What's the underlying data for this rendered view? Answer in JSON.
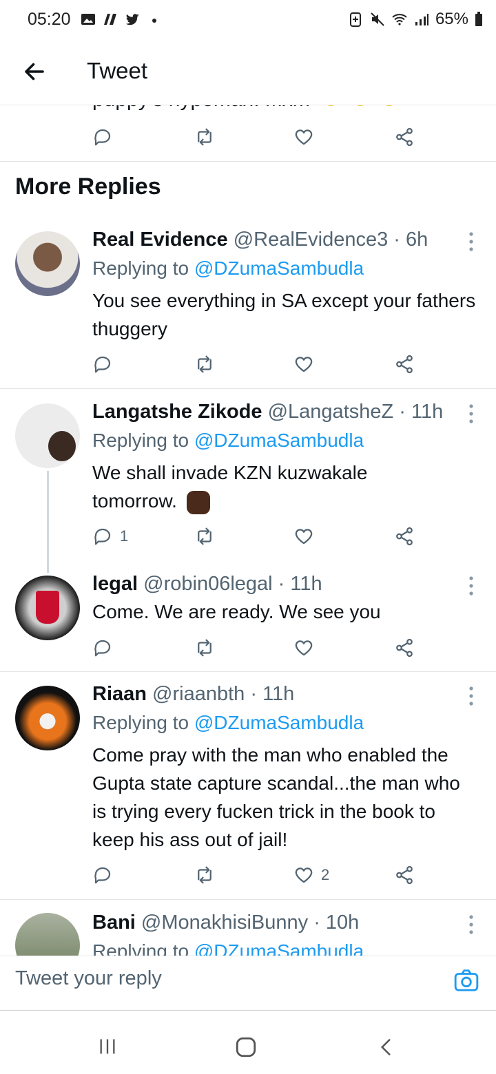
{
  "status_bar": {
    "time": "05:20",
    "battery": "65%"
  },
  "header": {
    "title": "Tweet"
  },
  "previous_tweet": {
    "cut_text": "puppy's hypeman. Mxm"
  },
  "section_title": "More Replies",
  "replies": [
    {
      "name": "Real Evidence",
      "handle": "@RealEvidence3",
      "time": "· 6h",
      "replying_prefix": "Replying to",
      "replying_handle": "@DZumaSambudla",
      "text": "You see everything in SA except your fathers thuggery",
      "reply_count": "",
      "like_count": ""
    },
    {
      "name": "Langatshe Zikode",
      "handle": "@LangatsheZ",
      "time": "· 11h",
      "replying_prefix": "Replying to",
      "replying_handle": "@DZumaSambudla",
      "text": "We shall invade KZN kuzwakale tomorrow.",
      "reply_count": "1",
      "like_count": ""
    },
    {
      "name": "legal",
      "handle": "@robin06legal",
      "time": "· 11h",
      "text": "Come.  We are ready. We see you",
      "reply_count": "",
      "like_count": ""
    },
    {
      "name": "Riaan",
      "handle": "@riaanbth",
      "time": "· 11h",
      "replying_prefix": "Replying to",
      "replying_handle": "@DZumaSambudla",
      "text": "Come pray with the man who enabled the Gupta state capture scandal...the man who is trying every fucken trick in the book to keep his ass out of jail!",
      "reply_count": "",
      "like_count": "2"
    },
    {
      "name": "Bani",
      "handle": "@MonakhisiBunny",
      "time": "· 10h",
      "replying_prefix": "Replying to",
      "replying_handle": "@DZumaSambudla"
    }
  ],
  "composer": {
    "placeholder": "Tweet your reply"
  },
  "icons": {
    "reply": "reply-icon",
    "retweet": "retweet-icon",
    "like": "heart-icon",
    "share": "share-icon",
    "back": "back-arrow-icon",
    "camera": "camera-icon",
    "more": "more-vertical-icon"
  },
  "colors": {
    "link": "#1d9bf0",
    "muted": "#536471",
    "text": "#0f1419"
  }
}
